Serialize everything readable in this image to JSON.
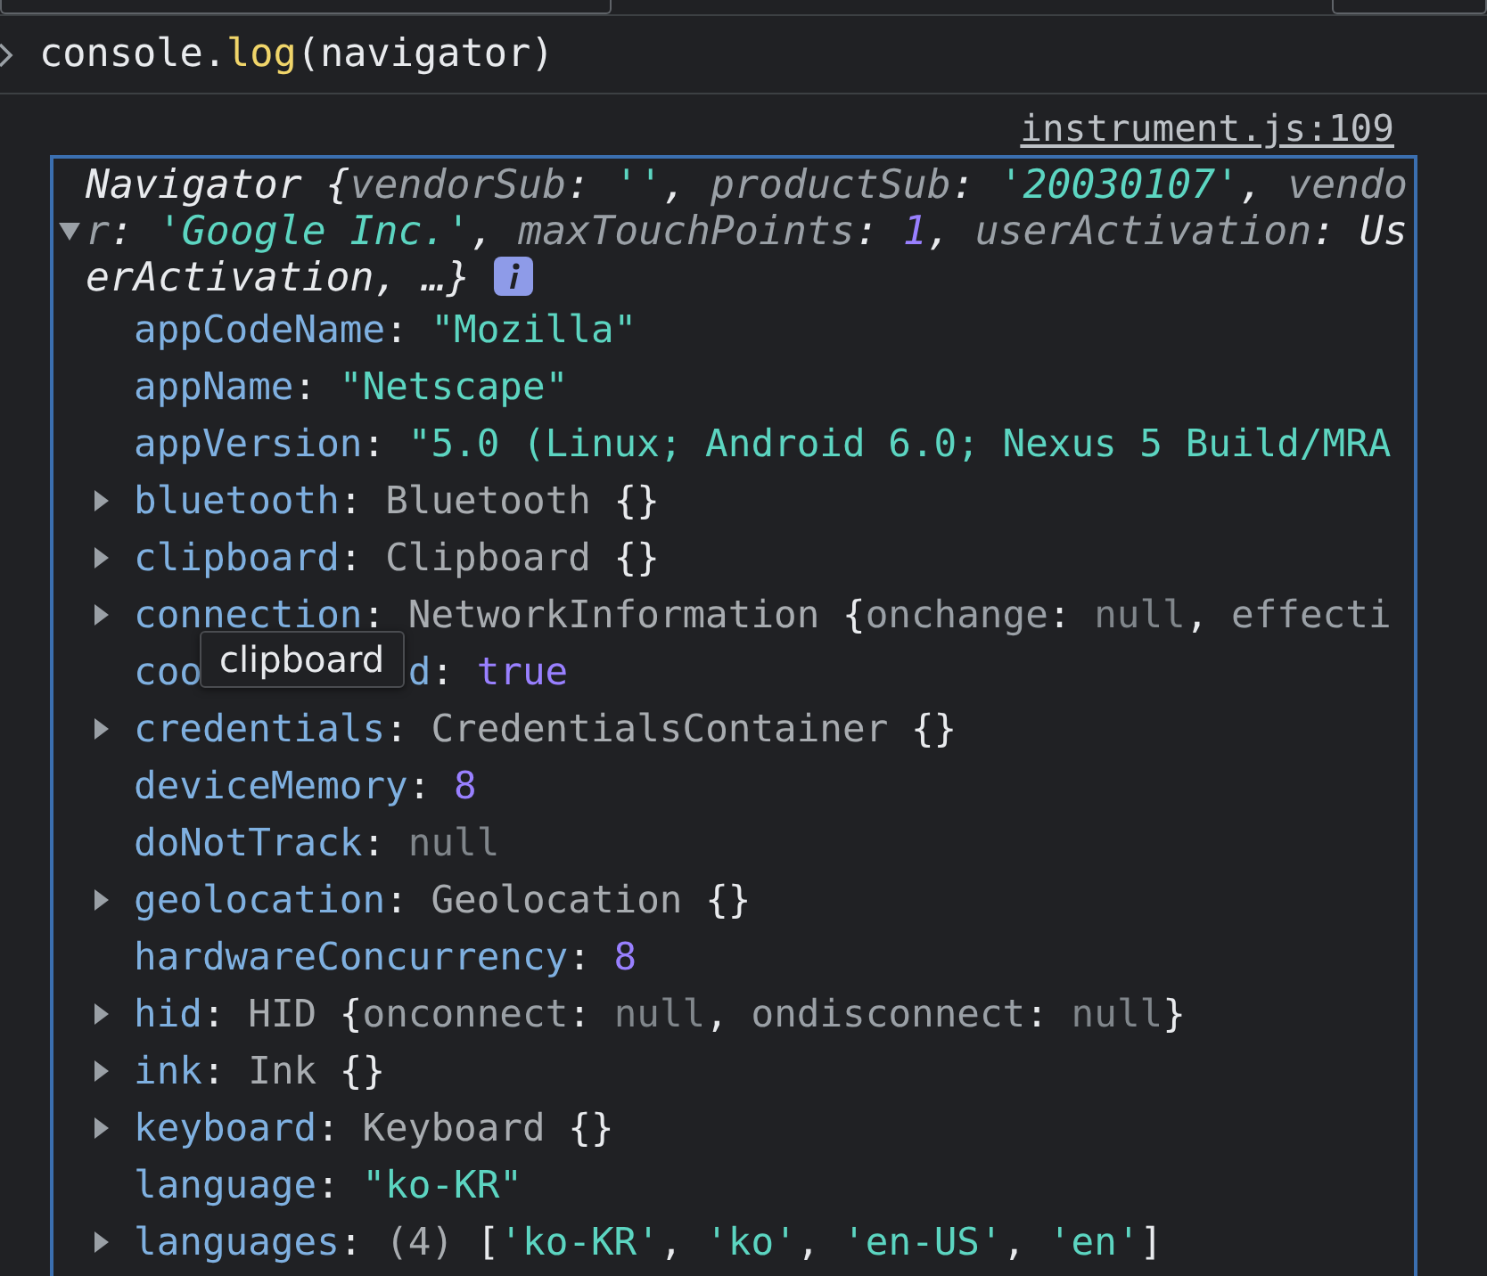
{
  "prompt": {
    "tokens": [
      {
        "kind": "plain",
        "text": "console."
      },
      {
        "kind": "method",
        "text": "log"
      },
      {
        "kind": "plain",
        "text": "(navigator)"
      }
    ]
  },
  "source_link": "instrument.js:109",
  "summary": {
    "expanded": true,
    "tokens": [
      {
        "kind": "plain",
        "text": "Navigator {"
      },
      {
        "kind": "key",
        "text": "vendorSub"
      },
      {
        "kind": "plain",
        "text": ": "
      },
      {
        "kind": "str",
        "text": "''"
      },
      {
        "kind": "plain",
        "text": ", "
      },
      {
        "kind": "key",
        "text": "productSub"
      },
      {
        "kind": "plain",
        "text": ": "
      },
      {
        "kind": "str",
        "text": "'20030107'"
      },
      {
        "kind": "plain",
        "text": ", "
      },
      {
        "kind": "key",
        "text": "vendor"
      },
      {
        "kind": "plain",
        "text": ": "
      },
      {
        "kind": "str",
        "text": "'Google Inc.'"
      },
      {
        "kind": "plain",
        "text": ", "
      },
      {
        "kind": "key",
        "text": "maxTouchPoints"
      },
      {
        "kind": "plain",
        "text": ": "
      },
      {
        "kind": "num",
        "text": "1"
      },
      {
        "kind": "plain",
        "text": ", "
      },
      {
        "kind": "key",
        "text": "userActivation"
      },
      {
        "kind": "plain",
        "text": ": "
      },
      {
        "kind": "plain",
        "text": "UserActivation, …}"
      }
    ]
  },
  "properties": [
    {
      "key": "appCodeName",
      "sep": ": ",
      "expandable": false,
      "value": [
        {
          "kind": "str",
          "text": "\"Mozilla\""
        }
      ]
    },
    {
      "key": "appName",
      "sep": ": ",
      "expandable": false,
      "value": [
        {
          "kind": "str",
          "text": "\"Netscape\""
        }
      ]
    },
    {
      "key": "appVersion",
      "sep": ": ",
      "expandable": false,
      "value": [
        {
          "kind": "str",
          "text": "\"5.0 (Linux; Android 6.0; Nexus 5 Build/MRA"
        }
      ]
    },
    {
      "key": "bluetooth",
      "sep": ": ",
      "expandable": true,
      "value": [
        {
          "kind": "cls",
          "text": "Bluetooth "
        },
        {
          "kind": "plain",
          "text": "{}"
        }
      ]
    },
    {
      "key": "clipboard",
      "sep": ": ",
      "expandable": true,
      "value": [
        {
          "kind": "cls",
          "text": "Clipboard "
        },
        {
          "kind": "plain",
          "text": "{}"
        }
      ]
    },
    {
      "key": "connection",
      "sep": ": ",
      "expandable": true,
      "value": [
        {
          "kind": "cls",
          "text": "NetworkInformation "
        },
        {
          "kind": "plain",
          "text": "{"
        },
        {
          "kind": "key",
          "text": "onchange"
        },
        {
          "kind": "plain",
          "text": ": "
        },
        {
          "kind": "nul",
          "text": "null"
        },
        {
          "kind": "plain",
          "text": ", "
        },
        {
          "kind": "key",
          "text": "effecti"
        }
      ]
    },
    {
      "key": "coo",
      "key_end": "d",
      "sep": ": ",
      "tooltip": "clipboard",
      "expandable": false,
      "value": [
        {
          "kind": "num",
          "text": "true"
        }
      ]
    },
    {
      "key": "credentials",
      "sep": ": ",
      "expandable": true,
      "value": [
        {
          "kind": "cls",
          "text": "CredentialsContainer "
        },
        {
          "kind": "plain",
          "text": "{}"
        }
      ]
    },
    {
      "key": "deviceMemory",
      "sep": ": ",
      "expandable": false,
      "value": [
        {
          "kind": "num",
          "text": "8"
        }
      ]
    },
    {
      "key": "doNotTrack",
      "sep": ": ",
      "expandable": false,
      "value": [
        {
          "kind": "nul",
          "text": "null"
        }
      ]
    },
    {
      "key": "geolocation",
      "sep": ": ",
      "expandable": true,
      "value": [
        {
          "kind": "cls",
          "text": "Geolocation "
        },
        {
          "kind": "plain",
          "text": "{}"
        }
      ]
    },
    {
      "key": "hardwareConcurrency",
      "sep": ": ",
      "expandable": false,
      "value": [
        {
          "kind": "num",
          "text": "8"
        }
      ]
    },
    {
      "key": "hid",
      "sep": ": ",
      "expandable": true,
      "value": [
        {
          "kind": "cls",
          "text": "HID "
        },
        {
          "kind": "plain",
          "text": "{"
        },
        {
          "kind": "key",
          "text": "onconnect"
        },
        {
          "kind": "plain",
          "text": ": "
        },
        {
          "kind": "nul",
          "text": "null"
        },
        {
          "kind": "plain",
          "text": ", "
        },
        {
          "kind": "key",
          "text": "ondisconnect"
        },
        {
          "kind": "plain",
          "text": ": "
        },
        {
          "kind": "nul",
          "text": "null"
        },
        {
          "kind": "plain",
          "text": "}"
        }
      ]
    },
    {
      "key": "ink",
      "sep": ": ",
      "expandable": true,
      "value": [
        {
          "kind": "cls",
          "text": "Ink "
        },
        {
          "kind": "plain",
          "text": "{}"
        }
      ]
    },
    {
      "key": "keyboard",
      "sep": ": ",
      "expandable": true,
      "value": [
        {
          "kind": "cls",
          "text": "Keyboard "
        },
        {
          "kind": "plain",
          "text": "{}"
        }
      ]
    },
    {
      "key": "language",
      "sep": ": ",
      "expandable": false,
      "value": [
        {
          "kind": "str",
          "text": "\"ko-KR\""
        }
      ]
    },
    {
      "key": "languages",
      "sep": ": ",
      "expandable": true,
      "value": [
        {
          "kind": "cls",
          "text": "(4) "
        },
        {
          "kind": "plain",
          "text": "["
        },
        {
          "kind": "str",
          "text": "'ko-KR'"
        },
        {
          "kind": "plain",
          "text": ", "
        },
        {
          "kind": "str",
          "text": "'ko'"
        },
        {
          "kind": "plain",
          "text": ", "
        },
        {
          "kind": "str",
          "text": "'en-US'"
        },
        {
          "kind": "plain",
          "text": ", "
        },
        {
          "kind": "str",
          "text": "'en'"
        },
        {
          "kind": "plain",
          "text": "]"
        }
      ]
    }
  ]
}
